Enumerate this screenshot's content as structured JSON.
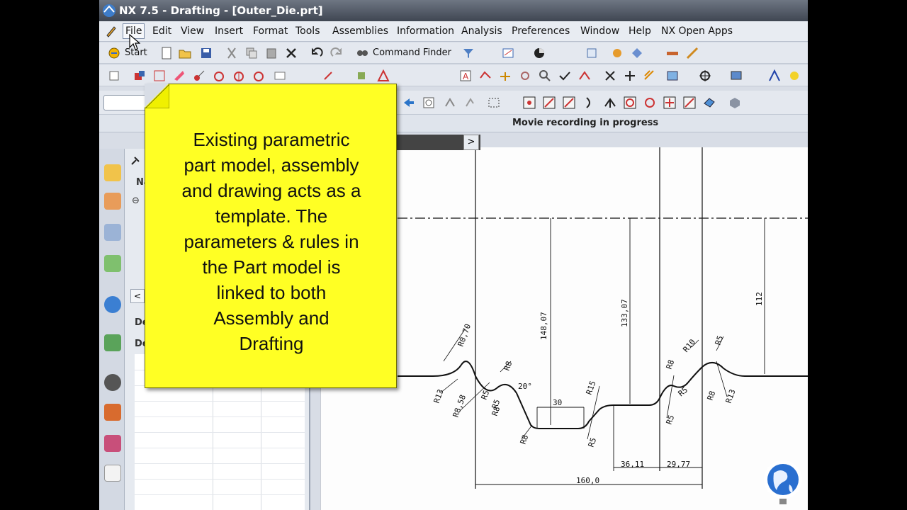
{
  "window": {
    "title": "NX 7.5 - Drafting - [Outer_Die.prt]"
  },
  "menu": [
    "File",
    "Edit",
    "View",
    "Insert",
    "Format",
    "Tools",
    "Assemblies",
    "Information",
    "Analysis",
    "Preferences",
    "Window",
    "Help",
    "NX Open Apps"
  ],
  "toolbar": {
    "start_label": "Start",
    "command_finder_label": "Command Finder"
  },
  "status": {
    "message": "Movie recording in progress"
  },
  "nav": {
    "col_name": "Na",
    "details_1": "De",
    "details_2": "De"
  },
  "callout": {
    "lines": [
      "Existing parametric",
      "part model, assembly",
      "and drawing acts as a",
      "template. The",
      "parameters & rules in",
      "the Part model is",
      "linked to both",
      "Assembly and",
      "Drafting"
    ]
  },
  "drawing": {
    "dimensions": {
      "d1": "148,07",
      "d2": "133,07",
      "d3": "112",
      "d4": "30",
      "d5": "36,11",
      "d6": "29,77",
      "d7": "160,0",
      "angle": "20°",
      "r1": "R0,70",
      "r2": "R13",
      "r3": "R8,58",
      "r4": "R8",
      "r5": "R5",
      "r6": "R5",
      "r7": "R15",
      "r8": "R8",
      "r9": "R10",
      "r10": "R5",
      "r11": "R5",
      "r12": "R8",
      "r13": "R13",
      "r14": "R5",
      "r15": "R8",
      "r16": "R5",
      "r17": "R8"
    }
  },
  "colors": {
    "callout": "#ffff24",
    "titlebar": "#4a525e"
  }
}
